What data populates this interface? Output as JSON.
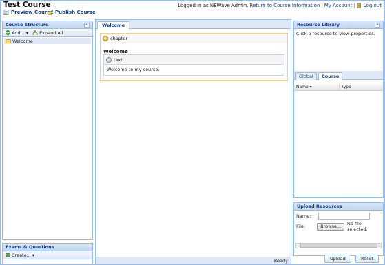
{
  "header": {
    "title": "Test Course",
    "preview_label": "Preview Course",
    "publish_label": "Publish Course",
    "logged_in_text": "Logged in as NEWave Admin.",
    "return_link": "Return to Course Information",
    "account_link": "My Account",
    "logout_link": "Log out"
  },
  "left_panel": {
    "title": "Course Structure",
    "toolbar": {
      "add_label": "Add...",
      "expand_label": "Expand All"
    },
    "tree": [
      {
        "label": "Welcome"
      }
    ]
  },
  "exams_panel": {
    "title": "Exams & Questions",
    "create_label": "Create..."
  },
  "center": {
    "tab_label": "Welcome",
    "chapter_label": "chapter",
    "chapter_title": "Welcome",
    "text_label": "text",
    "text_body": "Welcome to my course.",
    "status": "Ready"
  },
  "resource_library": {
    "title": "Resource Library",
    "message": "Click a resource to view properties.",
    "tabs": [
      "Global",
      "Course"
    ],
    "active_tab": "Course",
    "columns": [
      "Name",
      "Type"
    ]
  },
  "upload": {
    "title": "Upload Resources",
    "name_label": "Name:",
    "file_label": "File:",
    "browse_label": "Browse...",
    "file_status": "No file selected.",
    "upload_label": "Upload",
    "reset_label": "Reset"
  },
  "colors": {
    "accent": "#15428b",
    "panel_border": "#99bbe8",
    "chapter_border": "#f6cc97"
  }
}
